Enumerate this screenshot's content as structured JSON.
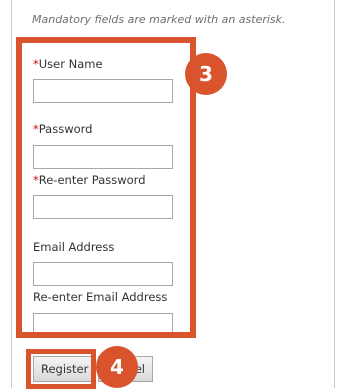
{
  "form": {
    "note": "Mandatory fields are marked with an asterisk.",
    "required_marker": "*",
    "fields": [
      {
        "label": "User Name",
        "required": true,
        "value": ""
      },
      {
        "label": "Password",
        "required": true,
        "value": ""
      },
      {
        "label": "Re-enter Password",
        "required": true,
        "value": ""
      },
      {
        "label": "Email Address",
        "required": false,
        "value": ""
      },
      {
        "label": "Re-enter Email Address",
        "required": false,
        "value": ""
      }
    ],
    "register_label": "Register",
    "cancel_label": "Cancel"
  },
  "callouts": {
    "form_step": "3",
    "button_step": "4",
    "color": "#d9542c"
  }
}
